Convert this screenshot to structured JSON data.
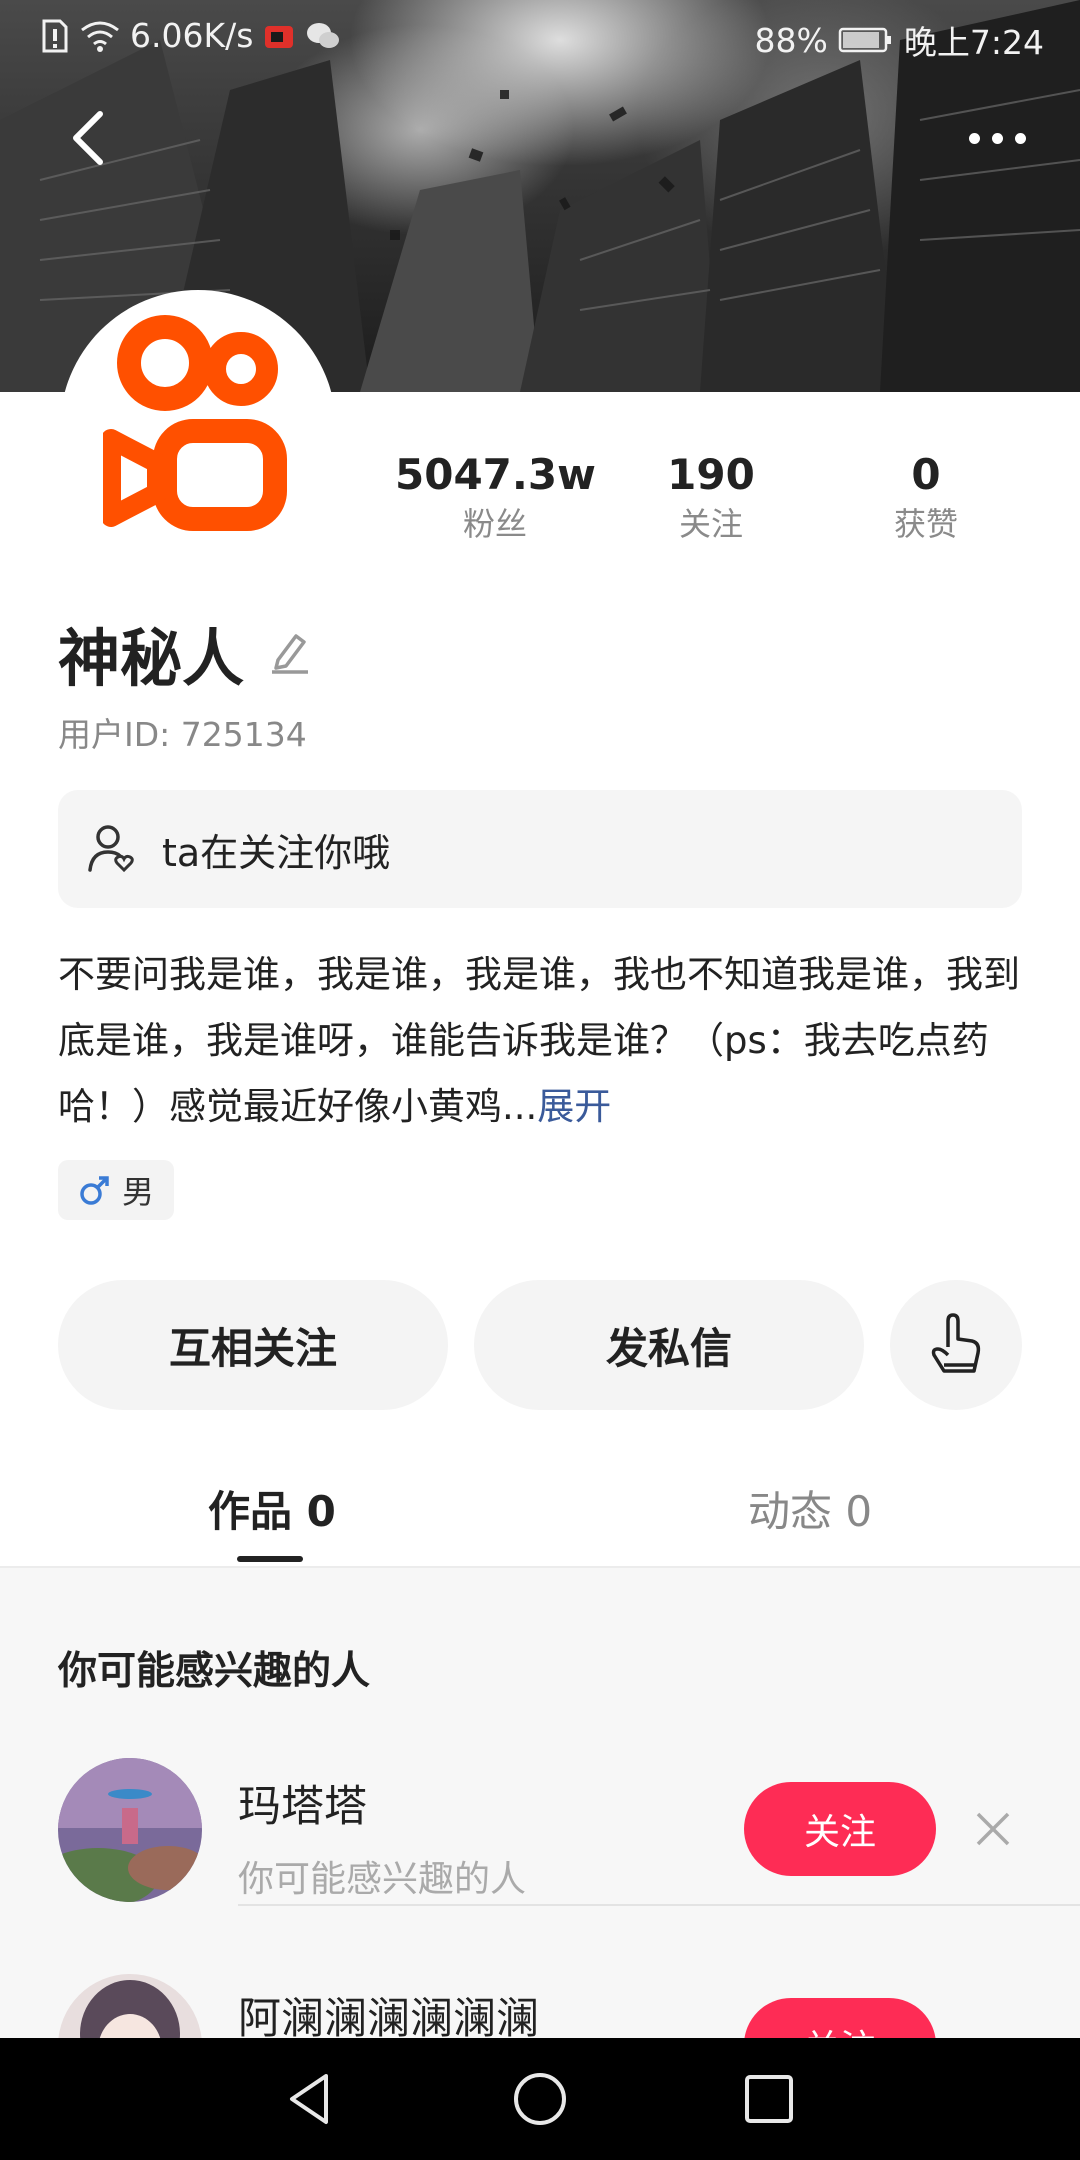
{
  "status_bar": {
    "net_speed": "6.06K/s",
    "battery": "88%",
    "time": "晚上7:24"
  },
  "header": {
    "back_icon": "chevron-left-icon",
    "more_icon": "more-dots-icon"
  },
  "profile": {
    "avatar_logo": "kuaishou-logo",
    "stats": [
      {
        "value": "5047.3w",
        "label": "粉丝"
      },
      {
        "value": "190",
        "label": "关注"
      },
      {
        "value": "0",
        "label": "获赞"
      }
    ],
    "name": "神秘人",
    "user_id": "用户ID: 725134",
    "follow_notice": "ta在关注你哦",
    "bio": "不要问我是谁，我是谁，我是谁，我也不知道我是谁，我到底是谁，我是谁呀，谁能告诉我是谁？（ps：我去吃点药哈！）感觉最近好像小黄鸡...",
    "bio_expand": "展开",
    "gender": "男"
  },
  "actions": {
    "mutual_follow": "互相关注",
    "send_message": "发私信",
    "poke_icon": "hand-pointer-icon"
  },
  "tabs": [
    {
      "label": "作品 0",
      "active": true
    },
    {
      "label": "动态 0",
      "active": false
    }
  ],
  "recommend": {
    "title": "你可能感兴趣的人",
    "items": [
      {
        "name": "玛塔塔",
        "subtitle": "你可能感兴趣的人",
        "button": "关注"
      },
      {
        "name": "阿澜澜澜澜澜澜",
        "subtitle": "",
        "button": "关注"
      }
    ]
  },
  "colors": {
    "accent": "#fe2c55",
    "logo_orange": "#ff5000",
    "link": "#3a5a9a"
  }
}
